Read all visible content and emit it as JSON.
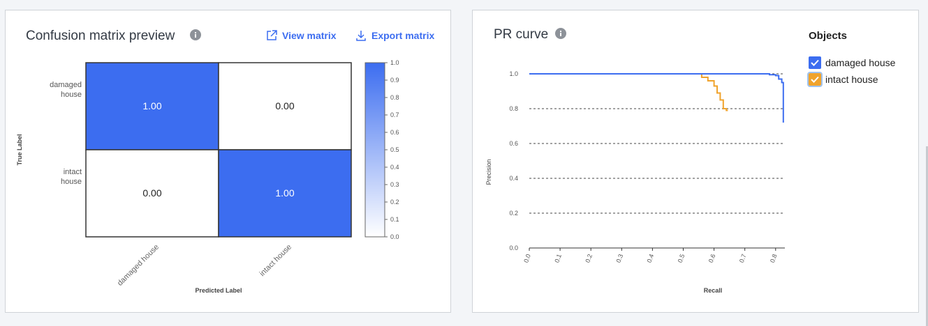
{
  "confusion_panel": {
    "title": "Confusion matrix preview",
    "info_icon": "info-icon",
    "view_label": "View matrix",
    "view_icon": "external-link-icon",
    "export_label": "Export matrix",
    "export_icon": "download-icon"
  },
  "pr_panel": {
    "title": "PR curve",
    "info_icon": "info-icon",
    "legend_title": "Objects"
  },
  "colors": {
    "accent": "#3c6df0",
    "orange": "#f0a32c",
    "text": "#333a44"
  },
  "chart_data": [
    {
      "type": "heatmap",
      "title": "Confusion matrix preview",
      "xlabel": "Predicted Label",
      "ylabel": "True Label",
      "x_categories": [
        "damaged house",
        "intact house"
      ],
      "y_categories": [
        "damaged house",
        "intact house"
      ],
      "y_category_lines": [
        [
          "damaged",
          "house"
        ],
        [
          "intact",
          "house"
        ]
      ],
      "values": [
        [
          1.0,
          0.0
        ],
        [
          0.0,
          1.0
        ]
      ],
      "value_labels": [
        [
          "1.00",
          "0.00"
        ],
        [
          "0.00",
          "1.00"
        ]
      ],
      "colorbar": {
        "range": [
          0,
          1
        ],
        "ticks": [
          "0.0",
          "0.1",
          "0.2",
          "0.3",
          "0.4",
          "0.5",
          "0.6",
          "0.7",
          "0.8",
          "0.9",
          "1.0"
        ],
        "low_color": "#ffffff",
        "high_color": "#3c6df0"
      }
    },
    {
      "type": "line",
      "title": "PR curve",
      "xlabel": "Recall",
      "ylabel": "Precision",
      "xlim": [
        0,
        0.83
      ],
      "ylim": [
        0,
        1.0
      ],
      "x_ticks": [
        "0.0",
        "0.1",
        "0.2",
        "0.3",
        "0.4",
        "0.5",
        "0.6",
        "0.7",
        "0.8"
      ],
      "y_ticks": [
        "0.0",
        "0.2",
        "0.4",
        "0.6",
        "0.8",
        "1.0"
      ],
      "grid": "horizontal dashed",
      "legend_placement": "right",
      "series": [
        {
          "name": "damaged house",
          "color": "#3c6df0",
          "points": [
            [
              0,
              1.0
            ],
            [
              0.78,
              1.0
            ],
            [
              0.78,
              0.995
            ],
            [
              0.8,
              0.995
            ],
            [
              0.8,
              0.99
            ],
            [
              0.81,
              0.99
            ],
            [
              0.81,
              0.97
            ],
            [
              0.82,
              0.97
            ],
            [
              0.82,
              0.95
            ],
            [
              0.825,
              0.95
            ],
            [
              0.825,
              0.72
            ]
          ]
        },
        {
          "name": "intact house",
          "color": "#f0a32c",
          "points": [
            [
              0,
              1.0
            ],
            [
              0.56,
              1.0
            ],
            [
              0.56,
              0.98
            ],
            [
              0.58,
              0.98
            ],
            [
              0.58,
              0.96
            ],
            [
              0.6,
              0.96
            ],
            [
              0.6,
              0.93
            ],
            [
              0.61,
              0.93
            ],
            [
              0.61,
              0.89
            ],
            [
              0.62,
              0.89
            ],
            [
              0.62,
              0.85
            ],
            [
              0.63,
              0.85
            ],
            [
              0.63,
              0.8
            ],
            [
              0.64,
              0.8
            ],
            [
              0.64,
              0.79
            ],
            [
              0.645,
              0.79
            ]
          ]
        }
      ]
    }
  ]
}
